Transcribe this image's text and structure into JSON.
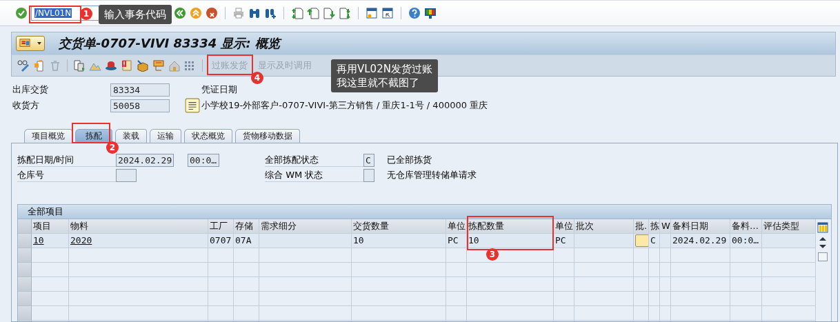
{
  "command_bar": {
    "command": "/NVL01N"
  },
  "title": "交货单-0707-VIVI 83334 显示: 概览",
  "app_toolbar": {
    "buttons": [
      {
        "label": "过账发货",
        "disabled": true
      },
      {
        "label": "显示及时调用",
        "disabled": true
      }
    ]
  },
  "header": {
    "fields": [
      {
        "label": "出库交货",
        "value": "83334"
      },
      {
        "label": "收货方",
        "value": "50058"
      }
    ],
    "document_date_label": "凭证日期",
    "ship_to_description": "小学校19-外部客户-0707-VIVI-第三方销售 / 重庆1-1号 / 400000 重庆"
  },
  "tabs": [
    {
      "label": "项目概览",
      "selected": false
    },
    {
      "label": "拣配",
      "selected": true
    },
    {
      "label": "装载",
      "selected": false
    },
    {
      "label": "运输",
      "selected": false
    },
    {
      "label": "状态概览",
      "selected": false
    },
    {
      "label": "货物移动数据",
      "selected": false
    }
  ],
  "picking": {
    "date_label": "拣配日期/时间",
    "date": "2024.02.29",
    "time": "00:0…",
    "warehouse_label": "仓库号",
    "overall_status_label": "全部拣配状态",
    "overall_status": "C",
    "overall_status_text": "已全部拣货",
    "wm_status_label": "综合 WM 状态",
    "wm_status_text": "无仓库管理转储单请求"
  },
  "table": {
    "title": "全部项目",
    "columns": [
      "项目",
      "物料",
      "工厂",
      "存储",
      "需求细分",
      "交货数量",
      "单位",
      "拣配数量",
      "单位",
      "批次",
      "批.",
      "拣",
      "W",
      "备料日期",
      "备料…",
      "评估类型"
    ],
    "rows": [
      [
        {
          "kind": "link",
          "text": "10"
        },
        {
          "kind": "link",
          "text": "2020"
        },
        {
          "kind": "text",
          "text": "0707"
        },
        {
          "kind": "text",
          "text": "07A"
        },
        {
          "kind": "empty"
        },
        {
          "kind": "text",
          "text": "10"
        },
        {
          "kind": "text",
          "text": "PC"
        },
        {
          "kind": "text",
          "text": "10"
        },
        {
          "kind": "text",
          "text": "PC"
        },
        {
          "kind": "empty"
        },
        {
          "kind": "button"
        },
        {
          "kind": "text",
          "text": "C"
        },
        {
          "kind": "empty"
        },
        {
          "kind": "text",
          "text": "2024.02.29"
        },
        {
          "kind": "text",
          "text": "00:0…"
        },
        {
          "kind": "empty"
        }
      ]
    ]
  },
  "annotations": [
    {
      "number": "1",
      "lines": [
        "输入事务代码"
      ]
    },
    {
      "number": "2"
    },
    {
      "number": "3"
    },
    {
      "number": "4",
      "lines": [
        "再用VL02N发货过账",
        "我这里就不截图了"
      ]
    }
  ]
}
